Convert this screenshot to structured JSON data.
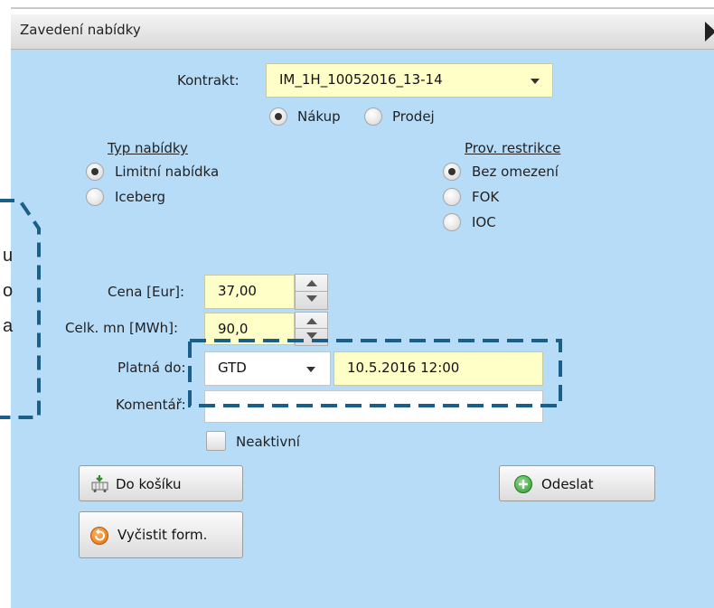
{
  "panel": {
    "title": "Zavedení nabídky",
    "colors": {
      "panel_bg": "#b7dcf8",
      "field_bg": "#ffffc8",
      "callout_border": "#1a5f8a"
    }
  },
  "contract": {
    "label": "Kontrakt:",
    "value": "IM_1H_10052016_13-14"
  },
  "direction": {
    "options": [
      {
        "label": "Nákup",
        "selected": true
      },
      {
        "label": "Prodej",
        "selected": false
      }
    ]
  },
  "offer_type": {
    "heading": "Typ nabídky",
    "options": [
      {
        "label": "Limitní nabídka",
        "selected": true
      },
      {
        "label": "Iceberg",
        "selected": false
      }
    ]
  },
  "restriction": {
    "heading": "Prov. restrikce",
    "options": [
      {
        "label": "Bez omezení",
        "selected": true
      },
      {
        "label": "FOK",
        "selected": false
      },
      {
        "label": "IOC",
        "selected": false
      }
    ]
  },
  "price": {
    "label": "Cena [Eur]:",
    "value": "37,00"
  },
  "quantity": {
    "label": "Celk. mn [MWh]:",
    "value": "90,0"
  },
  "validity": {
    "label": "Platná do:",
    "select_value": "GTD",
    "datetime_value": "10.5.2016 12:00"
  },
  "comment": {
    "label": "Komentář:",
    "value": ""
  },
  "inactive": {
    "label": "Neaktivní",
    "checked": false
  },
  "buttons": {
    "to_cart": "Do košíku",
    "send": "Odeslat",
    "clear_form": "Vyčistit form."
  },
  "callout": {
    "lines": [
      "u",
      "o",
      "a"
    ]
  }
}
